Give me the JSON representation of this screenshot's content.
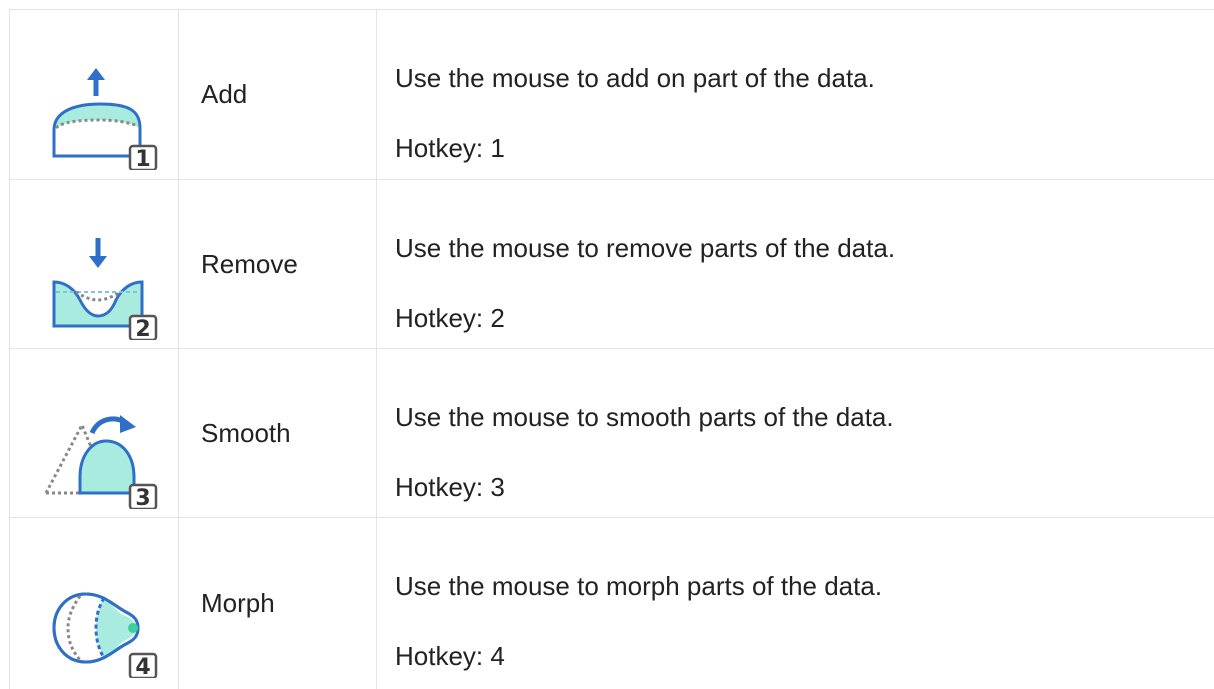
{
  "tools": [
    {
      "name": "Add",
      "description": "Use the mouse to add on part of the data.",
      "hotkey": "Hotkey: 1",
      "key": "1",
      "icon": "add-sculpt-icon"
    },
    {
      "name": "Remove",
      "description": "Use the mouse to remove parts of the data.",
      "hotkey": "Hotkey: 2",
      "key": "2",
      "icon": "remove-sculpt-icon"
    },
    {
      "name": "Smooth",
      "description": "Use the mouse to smooth parts of the data.",
      "hotkey": "Hotkey: 3",
      "key": "3",
      "icon": "smooth-sculpt-icon"
    },
    {
      "name": "Morph",
      "description": "Use the mouse to morph parts of the data.",
      "hotkey": "Hotkey: 4",
      "key": "4",
      "icon": "morph-sculpt-icon"
    }
  ],
  "colors": {
    "stroke": "#2f6fc7",
    "fill": "#a9ecdf",
    "dotted": "#888888",
    "keycap_border": "#555555",
    "grid": "#e4e4e4"
  }
}
